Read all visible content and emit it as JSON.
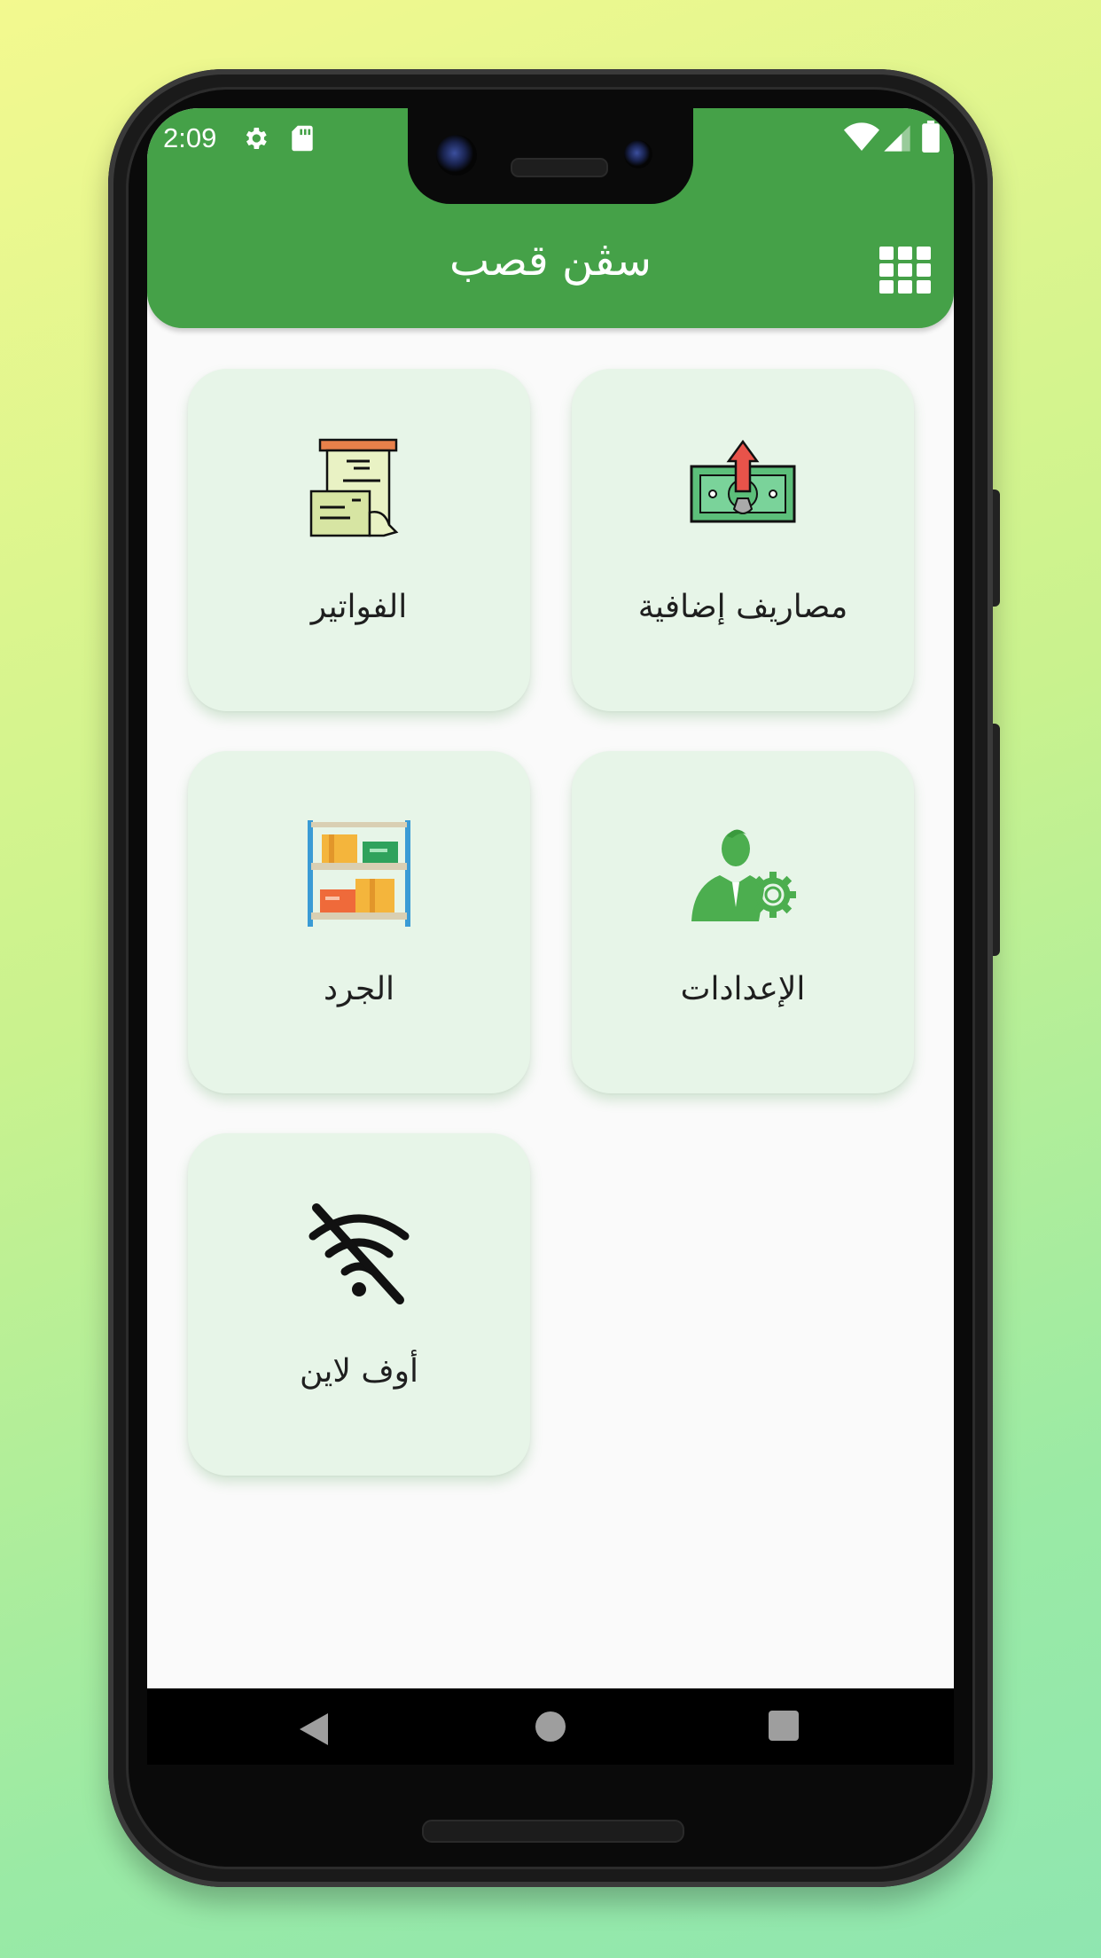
{
  "status_bar": {
    "time": "2:09",
    "left_icons": [
      "gear-icon",
      "sd-card-icon"
    ],
    "right_icons": [
      "wifi-icon",
      "signal-icon",
      "battery-icon"
    ]
  },
  "app_bar": {
    "title": "سڤن قصب",
    "menu_icon": "grid-icon",
    "color": "#45a148"
  },
  "menu": {
    "items": [
      {
        "label": "مصاريف إضافية",
        "icon": "money-withdraw-icon"
      },
      {
        "label": "الفواتير",
        "icon": "receipt-icon"
      },
      {
        "label": "الإعدادات",
        "icon": "user-settings-icon"
      },
      {
        "label": "الجرد",
        "icon": "inventory-shelf-icon"
      },
      {
        "label": "أوف لاين",
        "icon": "wifi-off-icon"
      }
    ],
    "card_color": "#e7f5e8"
  },
  "nav_bar": {
    "buttons": [
      "back-icon",
      "home-icon",
      "recents-icon"
    ]
  }
}
